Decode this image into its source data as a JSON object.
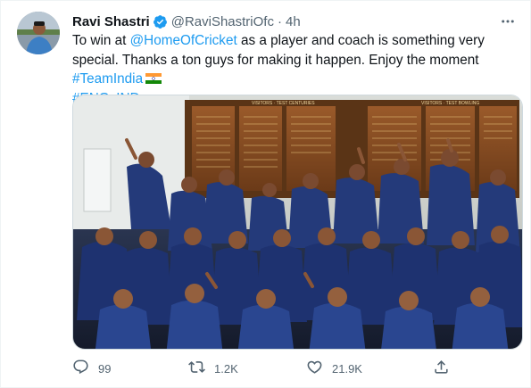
{
  "tweet": {
    "author_name": "Ravi Shastri",
    "author_handle": "@RaviShastriOfc",
    "separator": "·",
    "timestamp": "4h",
    "verified_icon": "verified-badge-icon",
    "text_line1_pre": "To win at ",
    "mention": "@HomeOfCricket",
    "text_line1_post": " as a player and coach is something very special.",
    "text_line2_pre": "Thanks a ton guys for making it happen. Enjoy the moment ",
    "hashtag1": "#TeamIndia",
    "hashtag2": "#ENGvIND",
    "flag_icon": "india-flag-icon",
    "media_subject": "team-celebration-photo"
  },
  "photo_signage": {
    "left_board": "VISITORS · TEST CENTURIES",
    "right_board": "VISITORS · TEST BOWLING"
  },
  "actions": {
    "reply_count": "99",
    "retweet_count": "1.2K",
    "like_count": "21.9K"
  },
  "colors": {
    "link": "#1d9bf0",
    "secondary_text": "#536471",
    "verified": "#1d9bf0"
  }
}
